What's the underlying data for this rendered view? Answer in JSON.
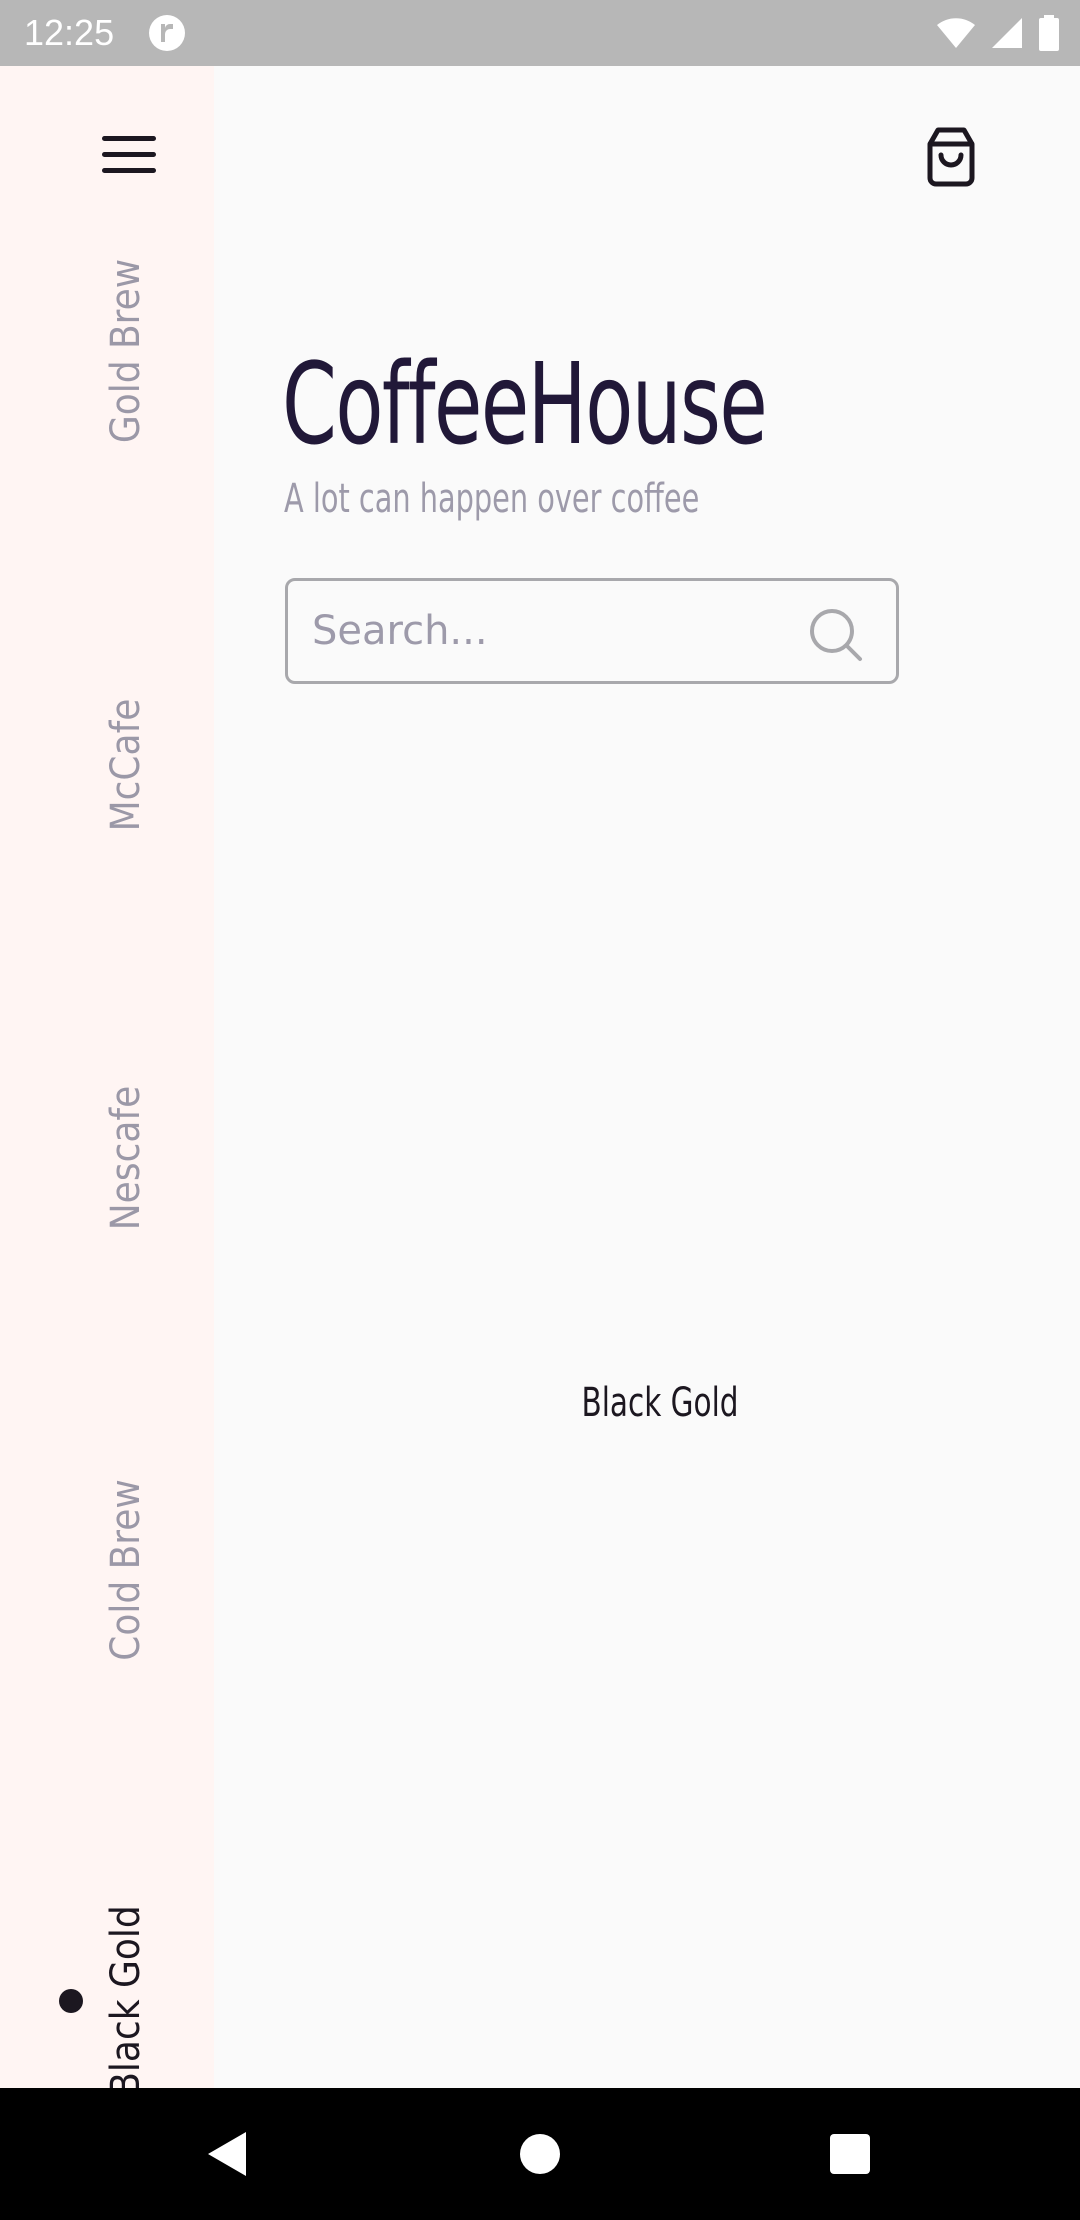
{
  "status_bar": {
    "time": "12:25",
    "icons": [
      "app-notification-icon",
      "wifi-icon",
      "cell-signal-icon",
      "battery-icon"
    ]
  },
  "sidebar": {
    "categories": [
      {
        "label": "Gold Brew",
        "active": false
      },
      {
        "label": "McCafe",
        "active": false
      },
      {
        "label": "Nescafe",
        "active": false
      },
      {
        "label": "Cold Brew",
        "active": false
      },
      {
        "label": "Black Gold",
        "active": true
      }
    ]
  },
  "header": {
    "title": "CoffeeHouse",
    "subtitle": "A lot can happen over coffee"
  },
  "search": {
    "placeholder": "Search...",
    "value": ""
  },
  "main": {
    "product_name": "Black Gold"
  },
  "colors": {
    "sidebar_bg": "#fff5f3",
    "page_bg": "#fafafa",
    "title": "#211838",
    "muted_text": "#9d9aaa",
    "active_text": "#1c1720"
  },
  "nav_bar": {
    "buttons": [
      "back-icon",
      "home-icon",
      "recents-icon"
    ]
  }
}
